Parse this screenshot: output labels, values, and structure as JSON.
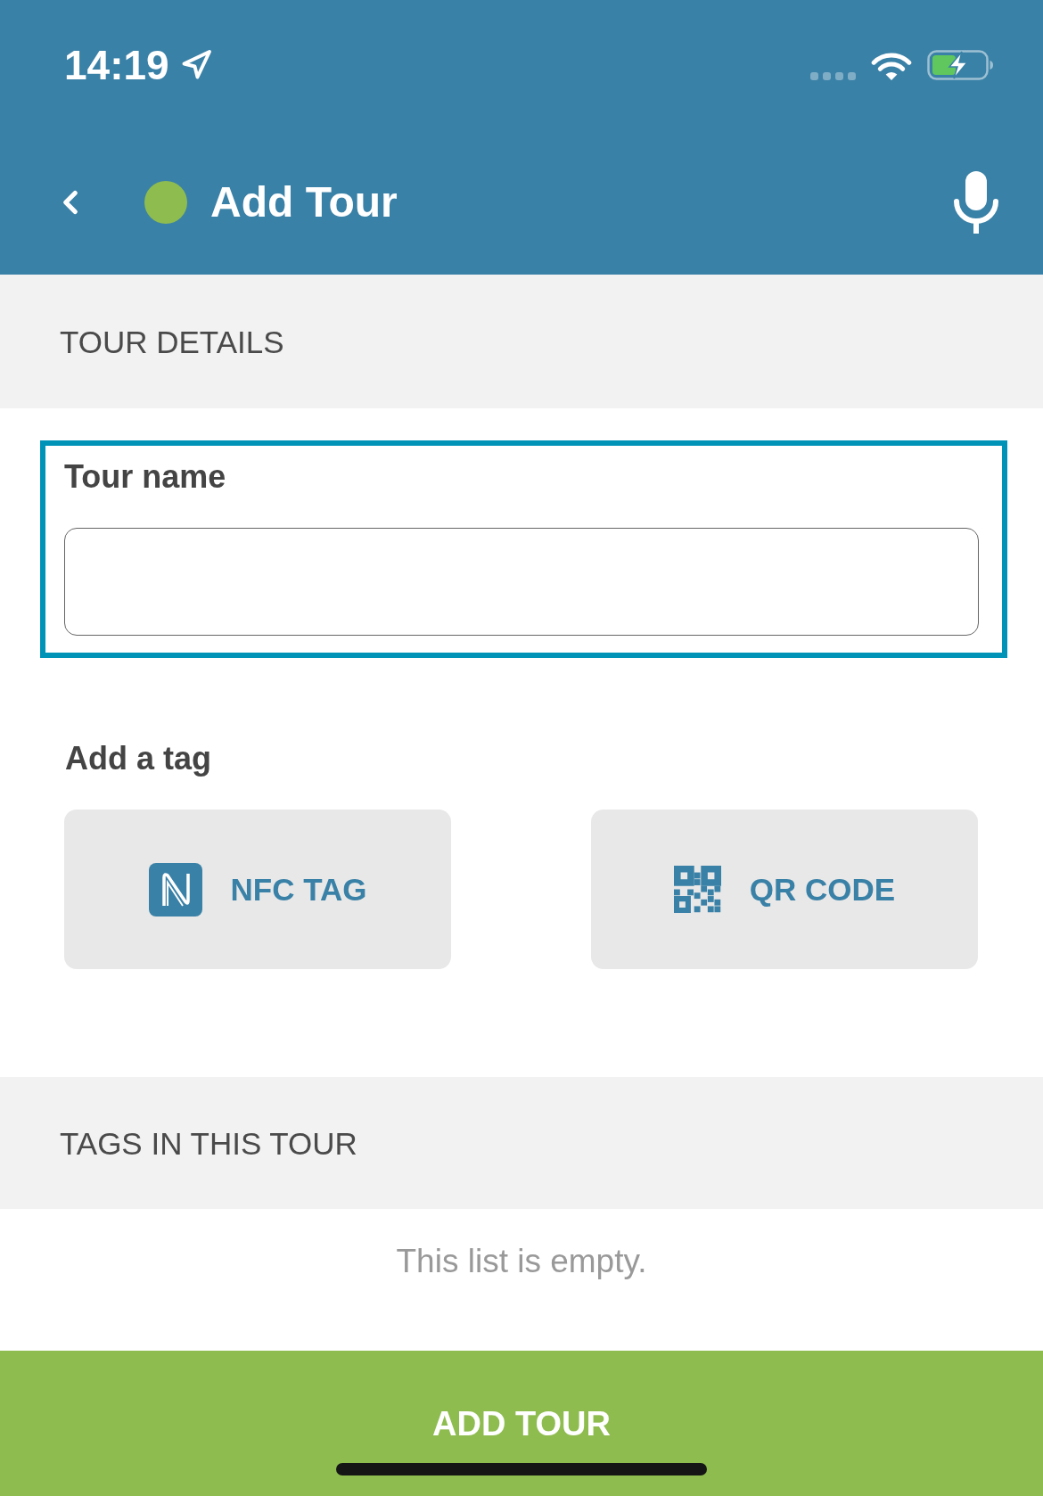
{
  "status_bar": {
    "time": "14:19"
  },
  "nav_bar": {
    "title": "Add Tour"
  },
  "tour_details": {
    "heading": "TOUR DETAILS",
    "tour_name": {
      "label": "Tour name",
      "focused": true
    },
    "add_tag": {
      "label": "Add a tag",
      "options": [
        {
          "kind": "nfc",
          "label": "NFC TAG"
        },
        {
          "kind": "qr",
          "label": "QR CODE"
        }
      ]
    }
  },
  "tags_in_tour": {
    "heading": "TAGS IN THIS TOUR",
    "empty_message": "This list is empty."
  },
  "submit_button": {
    "label": "ADD TOUR"
  }
}
